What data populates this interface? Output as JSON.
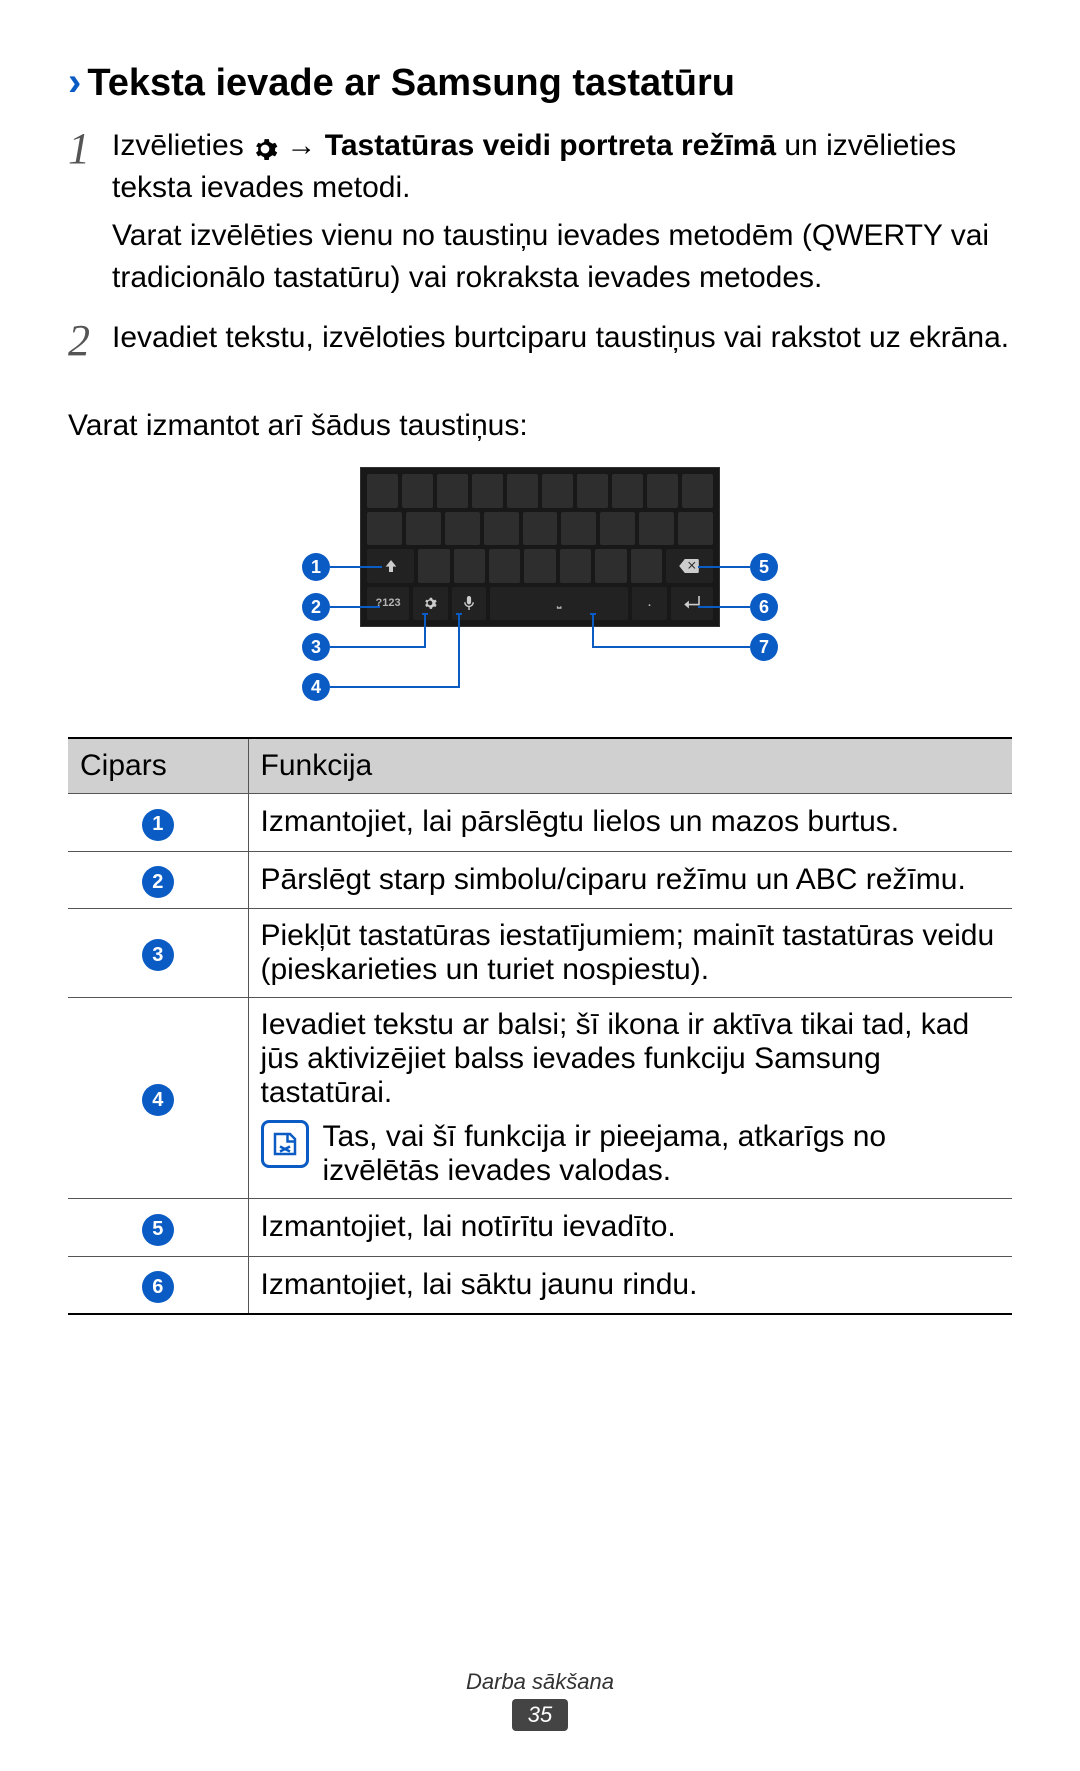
{
  "heading": "Teksta ievade ar Samsung tastatūru",
  "steps": {
    "1": {
      "pre": "Izvēlieties ",
      "arrow": " → ",
      "bold": "Tastatūras veidi portreta režīmā",
      "post": " un izvēlieties teksta ievades metodi.",
      "para2": "Varat izvēlēties vienu no taustiņu ievades metodēm (QWERTY vai tradicionālo tastatūru) vai rokraksta ievades metodes."
    },
    "2": {
      "text": "Ievadiet tekstu, izvēloties burtciparu taustiņus vai rakstot uz ekrāna."
    }
  },
  "intro_keys": "Varat izmantot arī šādus taustiņus:",
  "keyboard": {
    "sym_key": "?123"
  },
  "table": {
    "headers": {
      "num": "Cipars",
      "func": "Funkcija"
    },
    "rows": [
      {
        "n": "1",
        "f": "Izmantojiet, lai pārslēgtu lielos un mazos burtus."
      },
      {
        "n": "2",
        "f": "Pārslēgt starp simbolu/ciparu režīmu un ABC režīmu."
      },
      {
        "n": "3",
        "f": "Piekļūt tastatūras iestatījumiem; mainīt tastatūras veidu (pieskarieties un turiet nospiestu)."
      },
      {
        "n": "4",
        "f": "Ievadiet tekstu ar balsi; šī ikona ir aktīva tikai tad, kad jūs aktivizējiet balss ievades funkciju Samsung tastatūrai.",
        "note": "Tas, vai šī funkcija ir pieejama, atkarīgs no izvēlētās ievades valodas."
      },
      {
        "n": "5",
        "f": "Izmantojiet, lai notīrītu ievadīto."
      },
      {
        "n": "6",
        "f": "Izmantojiet, lai sāktu jaunu rindu."
      }
    ]
  },
  "footer": {
    "chapter": "Darba sākšana",
    "page": "35"
  }
}
